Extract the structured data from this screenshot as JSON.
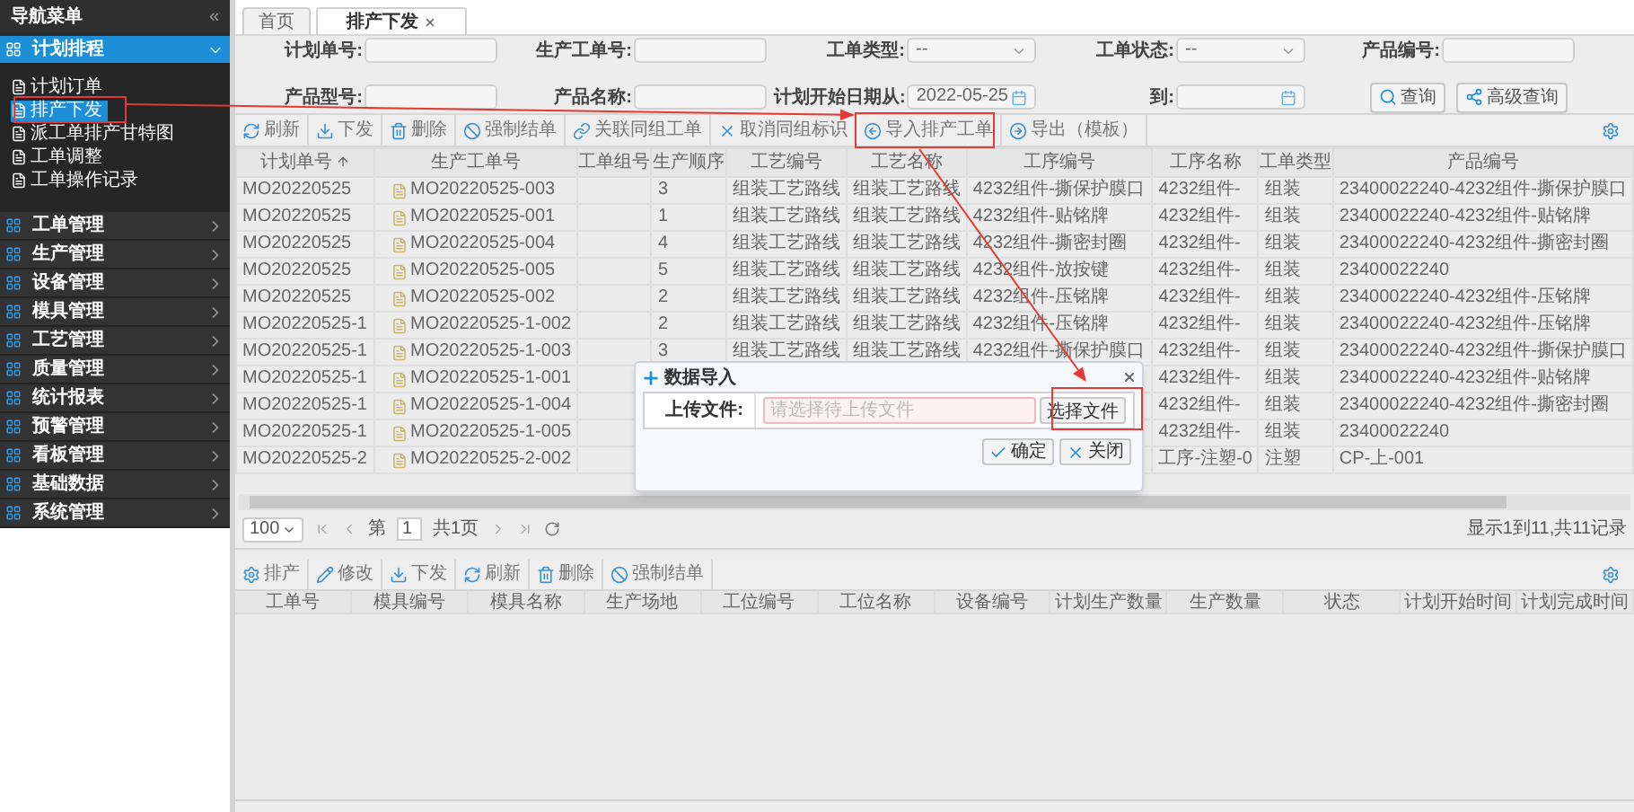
{
  "sidebar": {
    "title": "导航菜单",
    "collapse": "«",
    "sections": [
      {
        "label": "计划排程",
        "expanded": true,
        "children": [
          {
            "label": "计划订单",
            "selected": false
          },
          {
            "label": "排产下发",
            "selected": true
          },
          {
            "label": "派工单排产甘特图",
            "selected": false
          },
          {
            "label": "工单调整",
            "selected": false
          },
          {
            "label": "工单操作记录",
            "selected": false
          }
        ]
      },
      {
        "label": "工单管理",
        "expanded": false
      },
      {
        "label": "生产管理",
        "expanded": false
      },
      {
        "label": "设备管理",
        "expanded": false
      },
      {
        "label": "模具管理",
        "expanded": false
      },
      {
        "label": "工艺管理",
        "expanded": false
      },
      {
        "label": "质量管理",
        "expanded": false
      },
      {
        "label": "统计报表",
        "expanded": false
      },
      {
        "label": "预警管理",
        "expanded": false
      },
      {
        "label": "看板管理",
        "expanded": false
      },
      {
        "label": "基础数据",
        "expanded": false
      },
      {
        "label": "系统管理",
        "expanded": false
      }
    ]
  },
  "tabs": [
    {
      "label": "首页",
      "selected": false,
      "closable": false
    },
    {
      "label": "排产下发",
      "selected": true,
      "closable": true
    }
  ],
  "filters": [
    {
      "label": "计划单号:",
      "kind": "text"
    },
    {
      "label": "生产工单号:",
      "kind": "text"
    },
    {
      "label": "工单类型:",
      "kind": "select",
      "value": "--"
    },
    {
      "label": "工单状态:",
      "kind": "select",
      "value": "--"
    },
    {
      "label": "产品编号:",
      "kind": "text"
    },
    {
      "label": "产品型号:",
      "kind": "text"
    },
    {
      "label": "产品名称:",
      "kind": "text"
    },
    {
      "label": "计划开始日期从:",
      "kind": "date",
      "value": "2022-05-25"
    },
    {
      "label": "到:",
      "kind": "date"
    }
  ],
  "search_buttons": [
    {
      "label": "查询",
      "kind": "search"
    },
    {
      "label": "高级查询",
      "kind": "advanced"
    }
  ],
  "toolbar": [
    {
      "label": "刷新",
      "kind": "refresh"
    },
    {
      "label": "下发",
      "kind": "dispatch"
    },
    {
      "label": "删除",
      "kind": "delete"
    },
    {
      "label": "强制结单",
      "kind": "force"
    },
    {
      "label": "关联同组工单",
      "kind": "link"
    },
    {
      "label": "取消同组标识",
      "kind": "cancel"
    },
    {
      "label": "导入排产工单",
      "kind": "import"
    },
    {
      "label": "导出（模板）",
      "kind": "export"
    }
  ],
  "table": {
    "columns": [
      {
        "label": "计划单号",
        "sorted": true
      },
      {
        "label": "生产工单号",
        "sorted": false
      },
      {
        "label": "工单组号",
        "sorted": false
      },
      {
        "label": "生产顺序",
        "sorted": false
      },
      {
        "label": "工艺编号",
        "sorted": false
      },
      {
        "label": "工艺名称",
        "sorted": false
      },
      {
        "label": "工序编号",
        "sorted": false
      },
      {
        "label": "工序名称",
        "sorted": false
      },
      {
        "label": "工单类型",
        "sorted": false
      },
      {
        "label": "产品编号",
        "sorted": false
      }
    ],
    "rows": [
      {
        "plan_no": "MO20220525",
        "work_order": "MO20220525-003",
        "sequence": "3",
        "route_code": "组装工艺路线",
        "route_name": "组装工艺路线",
        "step_code": "4232组件-撕保护膜口",
        "step_name": "4232组件-",
        "order_type": "组装",
        "product_code": "23400022240-4232组件-撕保护膜口"
      },
      {
        "plan_no": "MO20220525",
        "work_order": "MO20220525-001",
        "sequence": "1",
        "route_code": "组装工艺路线",
        "route_name": "组装工艺路线",
        "step_code": "4232组件-贴铭牌",
        "step_name": "4232组件-",
        "order_type": "组装",
        "product_code": "23400022240-4232组件-贴铭牌"
      },
      {
        "plan_no": "MO20220525",
        "work_order": "MO20220525-004",
        "sequence": "4",
        "route_code": "组装工艺路线",
        "route_name": "组装工艺路线",
        "step_code": "4232组件-撕密封圈",
        "step_name": "4232组件-",
        "order_type": "组装",
        "product_code": "23400022240-4232组件-撕密封圈"
      },
      {
        "plan_no": "MO20220525",
        "work_order": "MO20220525-005",
        "sequence": "5",
        "route_code": "组装工艺路线",
        "route_name": "组装工艺路线",
        "step_code": "4232组件-放按键",
        "step_name": "4232组件-",
        "order_type": "组装",
        "product_code": "23400022240"
      },
      {
        "plan_no": "MO20220525",
        "work_order": "MO20220525-002",
        "sequence": "2",
        "route_code": "组装工艺路线",
        "route_name": "组装工艺路线",
        "step_code": "4232组件-压铭牌",
        "step_name": "4232组件-",
        "order_type": "组装",
        "product_code": "23400022240-4232组件-压铭牌"
      },
      {
        "plan_no": "MO20220525-1",
        "work_order": "MO20220525-1-002",
        "sequence": "2",
        "route_code": "组装工艺路线",
        "route_name": "组装工艺路线",
        "step_code": "4232组件-压铭牌",
        "step_name": "4232组件-",
        "order_type": "组装",
        "product_code": "23400022240-4232组件-压铭牌"
      },
      {
        "plan_no": "MO20220525-1",
        "work_order": "MO20220525-1-003",
        "sequence": "3",
        "route_code": "组装工艺路线",
        "route_name": "组装工艺路线",
        "step_code": "4232组件-撕保护膜口",
        "step_name": "4232组件-",
        "order_type": "组装",
        "product_code": "23400022240-4232组件-撕保护膜口"
      },
      {
        "plan_no": "MO20220525-1",
        "work_order": "MO20220525-1-001",
        "step_name": "4232组件-",
        "order_type": "组装",
        "product_code": "23400022240-4232组件-贴铭牌"
      },
      {
        "plan_no": "MO20220525-1",
        "work_order": "MO20220525-1-004",
        "step_name": "4232组件-",
        "order_type": "组装",
        "product_code": "23400022240-4232组件-撕密封圈"
      },
      {
        "plan_no": "MO20220525-1",
        "work_order": "MO20220525-1-005",
        "step_name": "4232组件-",
        "order_type": "组装",
        "product_code": "23400022240"
      },
      {
        "plan_no": "MO20220525-2",
        "work_order": "MO20220525-2-002",
        "step_name": "工序-注塑-0",
        "order_type": "注塑",
        "product_code": "CP-上-001"
      }
    ]
  },
  "pager": {
    "page_size": "100",
    "page_prefix": "第",
    "page": "1",
    "pages": "共1页",
    "summary": "显示1到11,共11记录"
  },
  "toolbar2": [
    {
      "label": "排产",
      "kind": "schedule"
    },
    {
      "label": "修改",
      "kind": "edit"
    },
    {
      "label": "下发",
      "kind": "dispatch"
    },
    {
      "label": "刷新",
      "kind": "refresh"
    },
    {
      "label": "删除",
      "kind": "delete"
    },
    {
      "label": "强制结单",
      "kind": "force"
    }
  ],
  "table2": {
    "columns": [
      "工单号",
      "模具编号",
      "模具名称",
      "生产场地",
      "工位编号",
      "工位名称",
      "设备编号",
      "计划生产数量",
      "生产数量",
      "状态",
      "计划开始时间",
      "计划完成时间"
    ]
  },
  "dialog": {
    "title": "数据导入",
    "field_label": "上传文件:",
    "placeholder": "请选择待上传文件",
    "file_button": "选择文件",
    "buttons": [
      {
        "label": "确定",
        "kind": "ok"
      },
      {
        "label": "关闭",
        "kind": "close"
      }
    ]
  }
}
